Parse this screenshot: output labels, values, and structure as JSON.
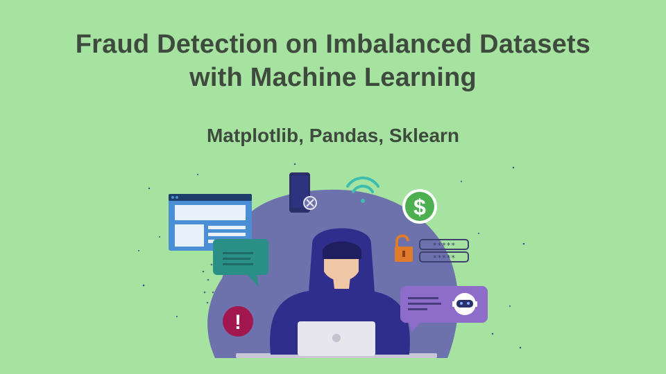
{
  "slide": {
    "title_line1": "Fraud Detection on Imbalanced Datasets",
    "title_line2": "with Machine Learning",
    "subtitle": "Matplotlib, Pandas, Sklearn"
  },
  "illustration": {
    "icons": [
      "browser-window-icon",
      "chat-bubble-icon",
      "alert-icon",
      "smartphone-blocked-icon",
      "wifi-icon",
      "dollar-coin-icon",
      "unlocked-padlock-icon",
      "password-field-icon",
      "chatbot-icon",
      "laptop-icon"
    ],
    "password_mask": "*****",
    "dollar_symbol": "$",
    "alert_symbol": "!",
    "colors": {
      "background": "#a6e3a0",
      "blob": "#6e72ac",
      "hacker": "#2f2e8c",
      "teal": "#2a8f86",
      "purple": "#8e6cc9",
      "blue_window": "#4a8fd6",
      "alert": "#a3174f",
      "coin": "#4caf50",
      "lock": "#e07b2c"
    }
  }
}
